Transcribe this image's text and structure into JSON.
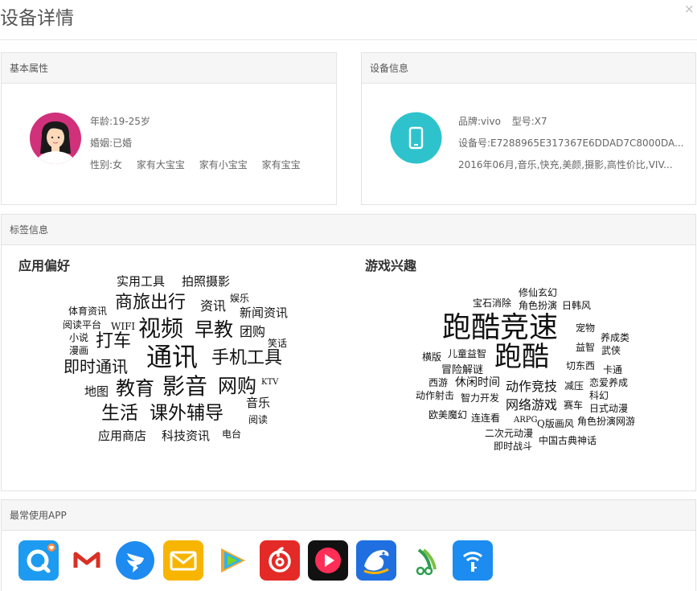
{
  "page": {
    "title": "设备详情",
    "close_glyph": "×"
  },
  "basic": {
    "header": "基本属性",
    "age": "年龄:19-25岁",
    "marriage": "婚姻:已婚",
    "gender": "性别:女",
    "tags": [
      "家有大宝宝",
      "家有小宝宝",
      "家有宝宝"
    ]
  },
  "device": {
    "header": "设备信息",
    "brand": "品牌:vivo",
    "model": "型号:X7",
    "device_id": "设备号:E7288965E317367E6DDAD7C8000DA...",
    "desc": "2016年06月,音乐,快充,美颜,摄影,高性价比,VIV..."
  },
  "tags_panel": {
    "header": "标签信息",
    "app_pref_title": "应用偏好",
    "game_title": "游戏兴趣",
    "app_words": [
      "实用工具",
      "拍照摄影",
      "商旅出行",
      "资讯",
      "娱乐",
      "体育资讯",
      "新闻资讯",
      "阅读平台",
      "WIFI",
      "视频",
      "早教",
      "团购",
      "小说",
      "打车",
      "笑话",
      "漫画",
      "通讯",
      "手机工具",
      "即时通讯",
      "KTV",
      "地图",
      "教育",
      "影音",
      "网购",
      "音乐",
      "生活",
      "课外辅导",
      "阅读",
      "应用商店",
      "科技资讯",
      "电台"
    ],
    "game_words": [
      "修仙玄幻",
      "宝石消除",
      "角色扮演",
      "日韩风",
      "跑酷竞速",
      "宠物",
      "养成类",
      "益智",
      "武侠",
      "横版",
      "儿童益智",
      "跑酷",
      "切东西",
      "卡通",
      "冒险解谜",
      "西游",
      "休闲时间",
      "动作竞技",
      "减压",
      "恋爱养成",
      "动作射击",
      "智力开发",
      "科幻",
      "网络游戏",
      "赛车",
      "日式动漫",
      "欧美魔幻",
      "连连看",
      "ARPG",
      "Q版画风",
      "角色扮演网游",
      "二次元动漫",
      "中国古典神话",
      "即时战斗"
    ]
  },
  "apps": {
    "header": "最常使用APP",
    "icons": [
      "q-search-icon",
      "gmail-icon",
      "dingtalk-icon",
      "mail-icon",
      "tencent-video-icon",
      "netease-music-icon",
      "video-player-icon",
      "ctrip-icon",
      "tree-frog-icon",
      "wifi-key-icon"
    ]
  },
  "colors": {
    "accent_teal": "#2ec3cc",
    "avatar_pink": "#d0317a"
  }
}
